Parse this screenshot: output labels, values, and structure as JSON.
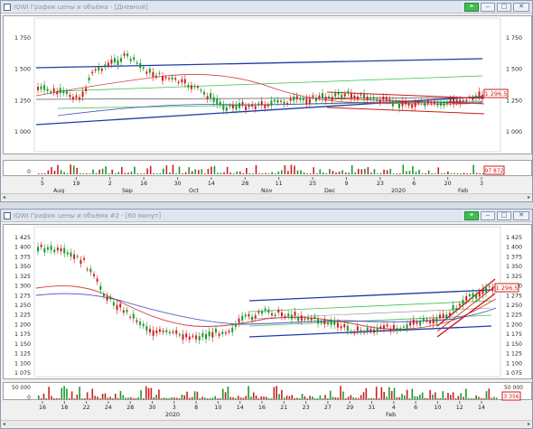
{
  "top_window": {
    "title": "IQWI График цены и объёма - [Дневной]",
    "price_badge": "1 296.5",
    "volume_badge": "97 872",
    "price_ticks": [
      "1 750",
      "1 500",
      "1 250",
      "1 000"
    ],
    "date_ticks": [
      "5",
      "19",
      "2",
      "16",
      "30",
      "14",
      "28",
      "11",
      "25",
      "9",
      "23",
      "6",
      "20",
      "3"
    ],
    "month_ticks": [
      "Aug",
      "Sep",
      "Oct",
      "Nov",
      "Dec",
      "2020",
      "Feb"
    ],
    "volume_tick": "0"
  },
  "bottom_window": {
    "title": "IQWI График цены и объёма #2 - [60 минут]",
    "price_badge": "1 296.5",
    "volume_badge": "3 356",
    "price_ticks": [
      "1 425",
      "1 400",
      "1 375",
      "1 350",
      "1 325",
      "1 300",
      "1 275",
      "1 250",
      "1 225",
      "1 200",
      "1 175",
      "1 150",
      "1 125",
      "1 100",
      "1 075"
    ],
    "date_ticks": [
      "16",
      "18",
      "22",
      "24",
      "28",
      "30",
      "3",
      "8",
      "10",
      "14",
      "16",
      "21",
      "23",
      "27",
      "29",
      "31",
      "4",
      "6",
      "10",
      "12",
      "14"
    ],
    "month_ticks": [
      "2020",
      "Feb"
    ],
    "volume_ticks": [
      "50 000",
      "0"
    ]
  },
  "buttons": {
    "link_icon": "link-icon",
    "minimize": "‒",
    "maximize": "□",
    "close": "✕"
  }
}
